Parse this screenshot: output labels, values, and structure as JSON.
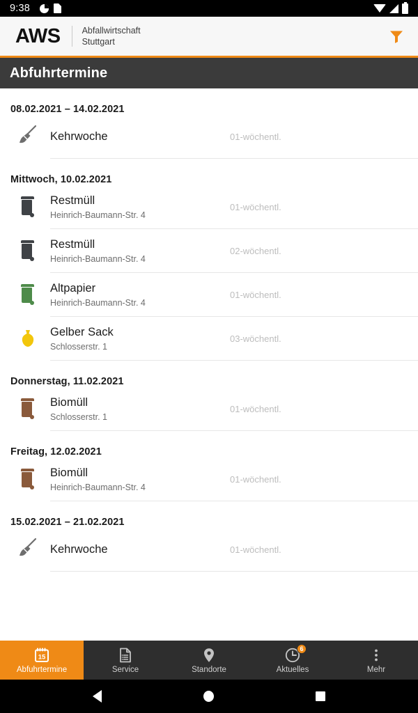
{
  "status_bar": {
    "time": "9:38",
    "left_icons": [
      "do-not-disturb-icon",
      "sd-card-icon"
    ],
    "right_icons": [
      "wifi-icon",
      "signal-icon",
      "battery-icon"
    ]
  },
  "app_header": {
    "logo": "AWS",
    "subtitle_line1": "Abfallwirtschaft",
    "subtitle_line2": "Stuttgart",
    "filter_icon": "filter-funnel-icon",
    "accent_color": "#ef8a16"
  },
  "page_title": "Abfuhrtermine",
  "list": {
    "sections": [
      {
        "header": "08.02.2021 – 14.02.2021",
        "rows": [
          {
            "icon": "broom-icon",
            "color": "#6e6e6e",
            "title": "Kehrwoche",
            "subtitle": "",
            "cycle": "01-wöchentl."
          }
        ]
      },
      {
        "header": "Mittwoch, 10.02.2021",
        "rows": [
          {
            "icon": "waste-bin-icon",
            "color": "#3f4246",
            "title": "Restmüll",
            "subtitle": "Heinrich-Baumann-Str. 4",
            "cycle": "01-wöchentl."
          },
          {
            "icon": "waste-bin-icon",
            "color": "#3f4246",
            "title": "Restmüll",
            "subtitle": "Heinrich-Baumann-Str. 4",
            "cycle": "02-wöchentl."
          },
          {
            "icon": "waste-bin-icon",
            "color": "#4e8b4a",
            "title": "Altpapier",
            "subtitle": "Heinrich-Baumann-Str. 4",
            "cycle": "01-wöchentl."
          },
          {
            "icon": "yellow-sack-icon",
            "color": "#f2c60c",
            "title": "Gelber Sack",
            "subtitle": "Schlosserstr. 1",
            "cycle": "03-wöchentl."
          }
        ]
      },
      {
        "header": "Donnerstag, 11.02.2021",
        "rows": [
          {
            "icon": "waste-bin-icon",
            "color": "#8a5a3b",
            "title": "Biomüll",
            "subtitle": "Schlosserstr. 1",
            "cycle": "01-wöchentl."
          }
        ]
      },
      {
        "header": "Freitag, 12.02.2021",
        "rows": [
          {
            "icon": "waste-bin-icon",
            "color": "#8a5a3b",
            "title": "Biomüll",
            "subtitle": "Heinrich-Baumann-Str. 4",
            "cycle": "01-wöchentl."
          }
        ]
      },
      {
        "header": "15.02.2021 – 21.02.2021",
        "rows": [
          {
            "icon": "broom-icon",
            "color": "#6e6e6e",
            "title": "Kehrwoche",
            "subtitle": "",
            "cycle": "01-wöchentl."
          }
        ]
      }
    ]
  },
  "bottom_nav": {
    "items": [
      {
        "label": "Abfuhrtermine",
        "icon": "calendar-icon",
        "icon_text": "15",
        "active": true,
        "badge": null
      },
      {
        "label": "Service",
        "icon": "document-list-icon",
        "active": false,
        "badge": null
      },
      {
        "label": "Standorte",
        "icon": "map-pin-icon",
        "active": false,
        "badge": null
      },
      {
        "label": "Aktuelles",
        "icon": "clock-icon",
        "active": false,
        "badge": "6"
      },
      {
        "label": "Mehr",
        "icon": "overflow-dots-icon",
        "active": false,
        "badge": null
      }
    ]
  },
  "system_nav": {
    "back": "back-triangle-icon",
    "home": "home-circle-icon",
    "recents": "recents-square-icon"
  }
}
